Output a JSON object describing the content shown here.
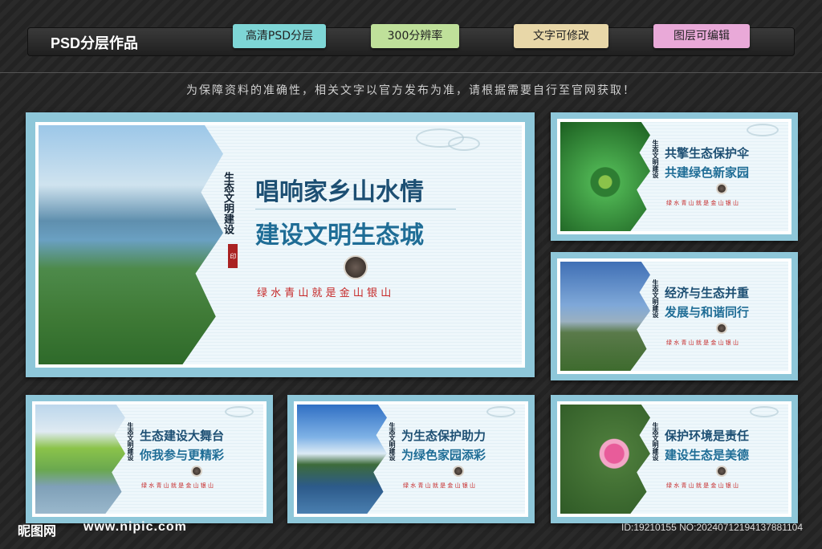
{
  "header": {
    "brand": "PSD分层作品",
    "tags": [
      {
        "label": "高清PSD分层",
        "color": "#7ed6d6"
      },
      {
        "label": "300分辨率",
        "color": "#bfe09a"
      },
      {
        "label": "文字可修改",
        "color": "#e8d7a8"
      },
      {
        "label": "图层可编辑",
        "color": "#e9a9d8"
      }
    ]
  },
  "notice": "为保障资料的准确性，相关文字以官方发布为准，请根据需要自行至官网获取！",
  "boards": [
    {
      "seal": "生态文明建设",
      "title1": "唱响家乡山水情",
      "title2": "建设文明生态城",
      "slogan": "绿 水 青 山 就 是 金 山 银 山"
    },
    {
      "seal": "生态文明建设",
      "title1": "共擎生态保护伞",
      "title2": "共建绿色新家园",
      "slogan": "绿 水 青 山 就 是 金 山 银 山"
    },
    {
      "seal": "生态文明建设",
      "title1": "经济与生态并重",
      "title2": "发展与和谐同行",
      "slogan": "绿 水 青 山 就 是 金 山 银 山"
    },
    {
      "seal": "生态文明建设",
      "title1": "生态建设大舞台",
      "title2": "你我参与更精彩",
      "slogan": "绿 水 青 山 就 是 金 山 银 山"
    },
    {
      "seal": "生态文明建设",
      "title1": "为生态保护助力",
      "title2": "为绿色家园添彩",
      "slogan": "绿 水 青 山 就 是 金 山 银 山"
    },
    {
      "seal": "生态文明建设",
      "title1": "保护环境是责任",
      "title2": "建设生态是美德",
      "slogan": "绿 水 青 山 就 是 金 山 银 山"
    }
  ],
  "footer": {
    "logo": "昵图网",
    "url": "www.nipic.com",
    "id": "ID:19210155 NO:20240712194137881104"
  }
}
